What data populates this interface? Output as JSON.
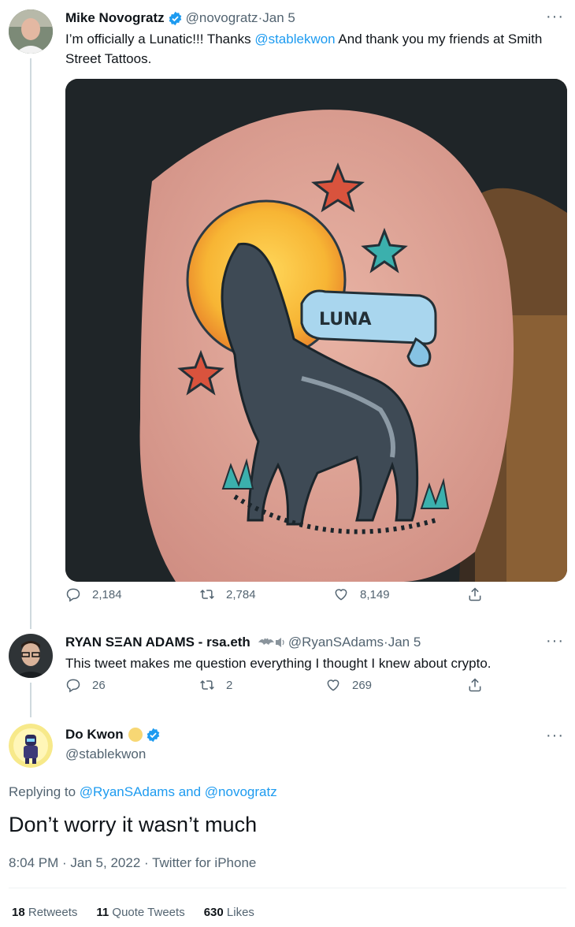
{
  "tweet1": {
    "name": "Mike Novogratz",
    "handle": "@novogratz",
    "date": "Jan 5",
    "text_pre": "I’m officially a Lunatic!!!  Thanks ",
    "mention": "@stablekwon",
    "text_post": "   And thank you my friends at Smith Street Tattoos.",
    "image_text": "LUNA",
    "replies": "2,184",
    "retweets": "2,784",
    "likes": "8,149"
  },
  "tweet2": {
    "name": "RYAN SΞAN ADAMS - rsa.eth",
    "handle": "@RyanSAdams",
    "date": "Jan 5",
    "text": "This tweet makes me question everything I thought I knew about crypto.",
    "replies": "26",
    "retweets": "2",
    "likes": "269"
  },
  "tweet3": {
    "name": "Do Kwon",
    "handle": "@stablekwon",
    "replying_label": "Replying to ",
    "reply_user1": "@RyanSAdams",
    "reply_and": " and ",
    "reply_user2": "@novogratz",
    "text": "Don’t worry it wasn’t much",
    "timestamp": "8:04 PM · Jan 5, 2022 · Twitter for iPhone",
    "retweets_count": "18",
    "retweets_label": " Retweets",
    "quotes_count": "11",
    "quotes_label": " Quote Tweets",
    "likes_count": "630",
    "likes_label": " Likes"
  },
  "ui": {
    "separator": " · ",
    "more_glyph": "···",
    "accent": "#1d9bf0",
    "icons": [
      "reply-icon",
      "retweet-icon",
      "like-icon",
      "share-icon",
      "verified-icon",
      "more-icon"
    ]
  }
}
